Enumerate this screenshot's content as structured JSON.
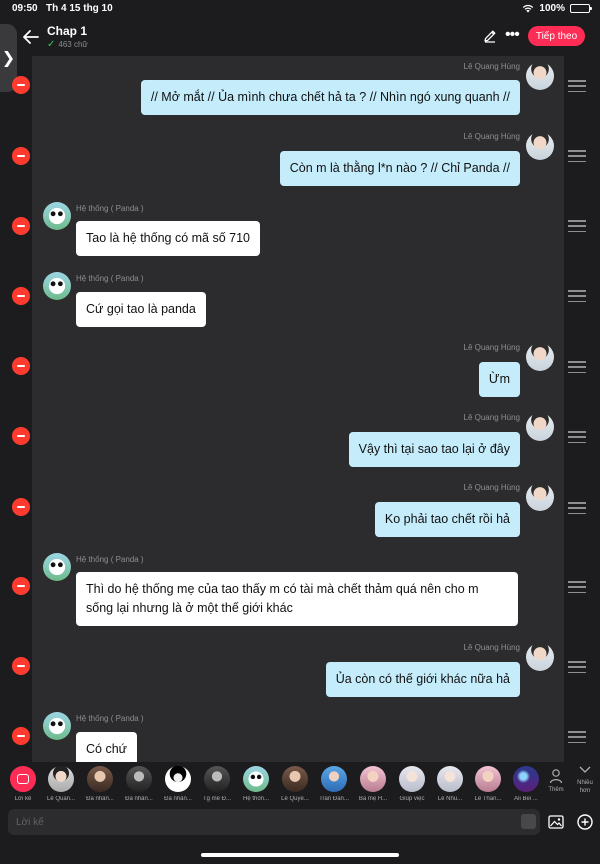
{
  "status": {
    "time": "09:50",
    "date": "Th 4 15 thg 10",
    "battery": "100%"
  },
  "header": {
    "title": "Chap 1",
    "word_count": "463 chữ",
    "next_label": "Tiếp theo",
    "edit_icon": "pencil-icon",
    "more_icon": "ellipsis-icon"
  },
  "messages": [
    {
      "side": "right",
      "sender": "Lê Quang Hùng",
      "text": "// Mở mắt // Ủa mình chưa chết hả ta ? // Nhìn ngó xung quanh //"
    },
    {
      "side": "right",
      "sender": "Lê Quang Hùng",
      "text": "Còn m là thằng l*n nào ? // Chỉ Panda //"
    },
    {
      "side": "left",
      "sender": "Hệ thống ( Panda )",
      "text": "Tao là hệ thống có mã số 710"
    },
    {
      "side": "left",
      "sender": "Hệ thống ( Panda )",
      "text": "Cứ gọi tao là panda"
    },
    {
      "side": "right",
      "sender": "Lê Quang Hùng",
      "text": "Ừm"
    },
    {
      "side": "right",
      "sender": "Lê Quang Hùng",
      "text": "Vậy thì tại sao tao lại ở đây"
    },
    {
      "side": "right",
      "sender": "Lê Quang Hùng",
      "text": "Ko phải tao chết rồi hả"
    },
    {
      "side": "left",
      "sender": "Hệ thống ( Panda )",
      "text": "Thì do hệ thống mẹ của tao thấy m có tài mà chết thảm quá nên cho m sống lại nhưng là ở một thế giới khác"
    },
    {
      "side": "right",
      "sender": "Lê Quang Hùng",
      "text": "Ủa còn có thế giới khác nữa hả"
    },
    {
      "side": "left",
      "sender": "Hệ thống ( Panda )",
      "text": "Có chứ"
    }
  ],
  "characters": [
    {
      "name": "Lời kể",
      "avatar": "narration-icon"
    },
    {
      "name": "Lê Quan...",
      "avatar": "user"
    },
    {
      "name": "Đa nhân...",
      "avatar": "warm"
    },
    {
      "name": "Đa nhân...",
      "avatar": "dark"
    },
    {
      "name": "Đa nhân...",
      "avatar": "bw"
    },
    {
      "name": "Tg mê Đ...",
      "avatar": "dark"
    },
    {
      "name": "Hệ thốn...",
      "avatar": "sys"
    },
    {
      "name": "Lê Quyề...",
      "avatar": "warm"
    },
    {
      "name": "Trần Đăn...",
      "avatar": "blue"
    },
    {
      "name": "Ba mẹ H...",
      "avatar": "pink"
    },
    {
      "name": "Giúp việc",
      "avatar": "pale"
    },
    {
      "name": "Lê Nhu...",
      "avatar": "pale"
    },
    {
      "name": "Lê Than...",
      "avatar": "pink"
    },
    {
      "name": "Ali Bei ...",
      "avatar": "galaxy"
    }
  ],
  "more_label": "Thêm",
  "many_label": "Nhiều hơn",
  "input": {
    "placeholder": "Lời kể"
  }
}
